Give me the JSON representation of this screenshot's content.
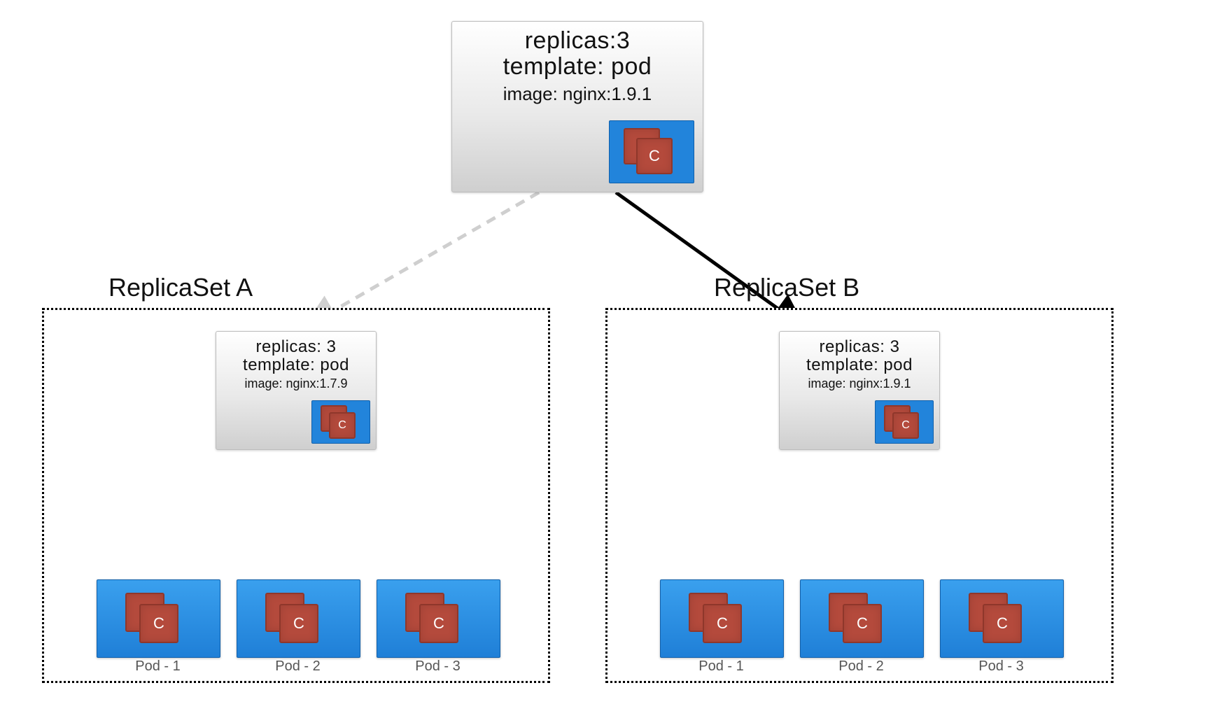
{
  "deployment": {
    "replicas_line": "replicas:3",
    "template_line": "template: pod",
    "image_line": "image: nginx:1.9.1"
  },
  "icon_letter": "C",
  "replicaSetA": {
    "title": "ReplicaSet A",
    "spec": {
      "replicas_line": "replicas: 3",
      "template_line": "template: pod",
      "image_line": "image: nginx:1.7.9"
    },
    "pods": [
      "Pod - 1",
      "Pod - 2",
      "Pod - 3"
    ]
  },
  "replicaSetB": {
    "title": "ReplicaSet B",
    "spec": {
      "replicas_line": "replicas: 3",
      "template_line": "template: pod",
      "image_line": "image: nginx:1.9.1"
    },
    "pods": [
      "Pod - 1",
      "Pod - 2",
      "Pod - 3"
    ]
  }
}
